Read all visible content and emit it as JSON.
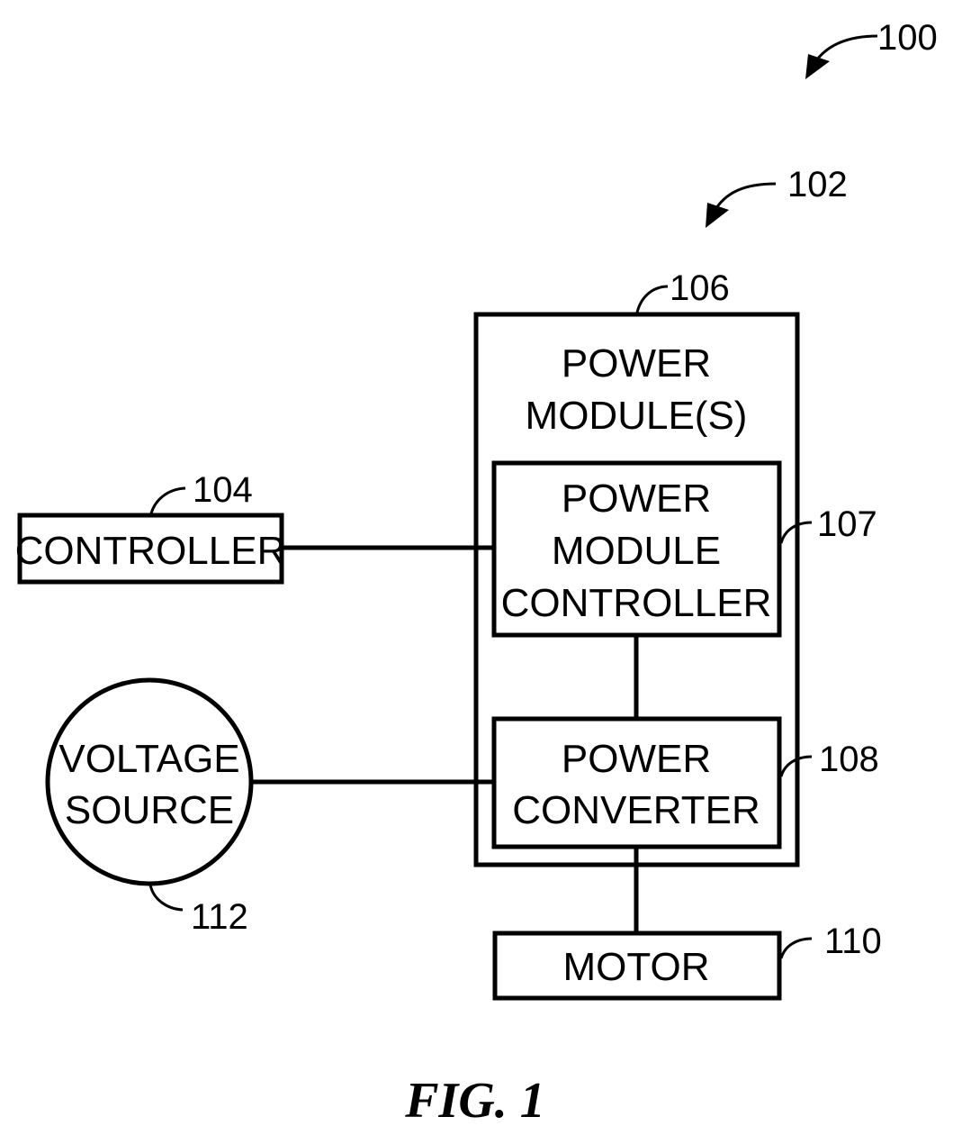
{
  "figure": {
    "caption": "FIG. 1",
    "system_ref": "100",
    "subsystem_ref": "102"
  },
  "blocks": {
    "controller": {
      "label": "CONTROLLER",
      "ref": "104"
    },
    "power_modules": {
      "label_line1": "POWER",
      "label_line2": "MODULE(S)",
      "ref": "106"
    },
    "power_module_controller": {
      "label_line1": "POWER",
      "label_line2": "MODULE",
      "label_line3": "CONTROLLER",
      "ref": "107"
    },
    "power_converter": {
      "label_line1": "POWER",
      "label_line2": "CONVERTER",
      "ref": "108"
    },
    "motor": {
      "label": "MOTOR",
      "ref": "110"
    },
    "voltage_source": {
      "label_line1": "VOLTAGE",
      "label_line2": "SOURCE",
      "ref": "112"
    }
  },
  "connections": [
    {
      "from": "CONTROLLER",
      "to": "POWER MODULE CONTROLLER"
    },
    {
      "from": "POWER MODULE CONTROLLER",
      "to": "POWER CONVERTER"
    },
    {
      "from": "VOLTAGE SOURCE",
      "to": "POWER CONVERTER"
    },
    {
      "from": "POWER CONVERTER",
      "to": "MOTOR"
    }
  ]
}
